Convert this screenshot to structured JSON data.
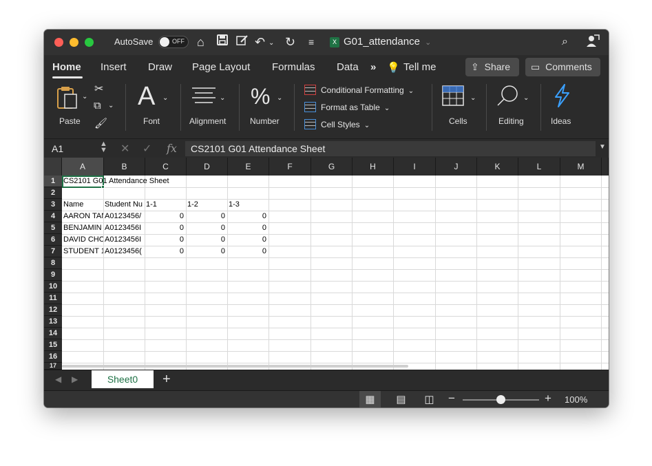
{
  "titlebar": {
    "autosave_label": "AutoSave",
    "autosave_state": "OFF",
    "doc_title": "G01_attendance",
    "app_badge": "X"
  },
  "tabs": {
    "home": "Home",
    "insert": "Insert",
    "draw": "Draw",
    "page_layout": "Page Layout",
    "formulas": "Formulas",
    "data": "Data",
    "more": "»",
    "tell_me": "Tell me",
    "share": "Share",
    "comments": "Comments"
  },
  "ribbon": {
    "paste": "Paste",
    "font": "Font",
    "alignment": "Alignment",
    "number": "Number",
    "conditional_formatting": "Conditional Formatting",
    "format_as_table": "Format as Table",
    "cell_styles": "Cell Styles",
    "cells": "Cells",
    "editing": "Editing",
    "ideas": "Ideas",
    "font_glyph": "A",
    "number_glyph": "%"
  },
  "formula_bar": {
    "name_box": "A1",
    "fx": "fx",
    "content": "CS2101 G01 Attendance Sheet"
  },
  "grid": {
    "columns": [
      "A",
      "B",
      "C",
      "D",
      "E",
      "F",
      "G",
      "H",
      "I",
      "J",
      "K",
      "L",
      "M"
    ],
    "rows": [
      "1",
      "2",
      "3",
      "4",
      "5",
      "6",
      "7",
      "8",
      "9",
      "10",
      "11",
      "12",
      "13",
      "14",
      "15",
      "16",
      "17"
    ],
    "cells": {
      "r1_a": "CS2101 G01 Attendance Sheet",
      "r3_a": "Name",
      "r3_b": "Student Nu",
      "r3_c": "1-1",
      "r3_d": "1-2",
      "r3_e": "1-3",
      "r4_a": "AARON TAN",
      "r4_b": "A0123456/",
      "r4_c": "0",
      "r4_d": "0",
      "r4_e": "0",
      "r5_a": "BENJAMIN",
      "r5_b": "A0123456I",
      "r5_c": "0",
      "r5_d": "0",
      "r5_e": "0",
      "r6_a": "DAVID CHO",
      "r6_b": "A0123456I",
      "r6_c": "0",
      "r6_d": "0",
      "r6_e": "0",
      "r7_a": "STUDENT 1",
      "r7_b": "A0123456(",
      "r7_c": "0",
      "r7_d": "0",
      "r7_e": "0"
    }
  },
  "sheets": {
    "active": "Sheet0",
    "add": "+"
  },
  "status": {
    "zoom": "100%"
  },
  "colors": {
    "accent_green": "#1e7145",
    "chrome_dark": "#2b2b2b"
  }
}
